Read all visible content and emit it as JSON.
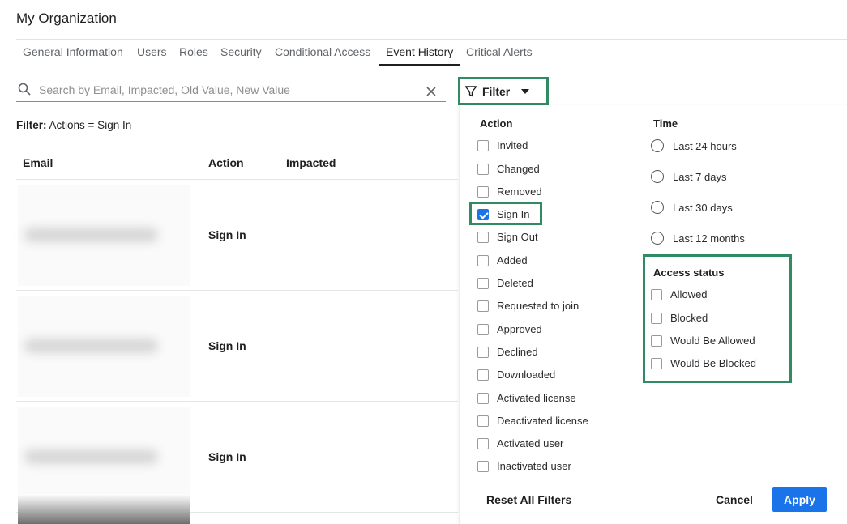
{
  "page": {
    "title": "My Organization"
  },
  "tabs": [
    "General Information",
    "Users",
    "Roles",
    "Security",
    "Conditional Access",
    "Event History",
    "Critical Alerts"
  ],
  "active_tab": "Event History",
  "search": {
    "placeholder": "Search by Email, Impacted, Old Value, New Value",
    "value": ""
  },
  "filter_button": {
    "label": "Filter"
  },
  "filter_summary": {
    "prefix": "Filter:",
    "text": "Actions = Sign In"
  },
  "table": {
    "headers": {
      "email": "Email",
      "action": "Action",
      "impacted": "Impacted"
    },
    "rows": [
      {
        "action": "Sign In",
        "impacted": "-"
      },
      {
        "action": "Sign In",
        "impacted": "-"
      },
      {
        "action": "Sign In",
        "impacted": "-"
      }
    ]
  },
  "filter_panel": {
    "action_title": "Action",
    "actions": [
      {
        "label": "Invited",
        "checked": false
      },
      {
        "label": "Changed",
        "checked": false
      },
      {
        "label": "Removed",
        "checked": false
      },
      {
        "label": "Sign In",
        "checked": true
      },
      {
        "label": "Sign Out",
        "checked": false
      },
      {
        "label": "Added",
        "checked": false
      },
      {
        "label": "Deleted",
        "checked": false
      },
      {
        "label": "Requested to join",
        "checked": false
      },
      {
        "label": "Approved",
        "checked": false
      },
      {
        "label": "Declined",
        "checked": false
      },
      {
        "label": "Downloaded",
        "checked": false
      },
      {
        "label": "Activated license",
        "checked": false
      },
      {
        "label": "Deactivated license",
        "checked": false
      },
      {
        "label": "Activated user",
        "checked": false
      },
      {
        "label": "Inactivated user",
        "checked": false
      }
    ],
    "time_title": "Time",
    "times": [
      "Last 24 hours",
      "Last 7 days",
      "Last 30 days",
      "Last 12 months"
    ],
    "access_title": "Access status",
    "access": [
      {
        "label": "Allowed",
        "checked": false
      },
      {
        "label": "Blocked",
        "checked": false
      },
      {
        "label": "Would Be Allowed",
        "checked": false
      },
      {
        "label": "Would Be Blocked",
        "checked": false
      }
    ],
    "reset_label": "Reset All Filters",
    "cancel_label": "Cancel",
    "apply_label": "Apply"
  },
  "colors": {
    "accent": "#1a73e8",
    "highlight_border": "#2e8b62"
  }
}
